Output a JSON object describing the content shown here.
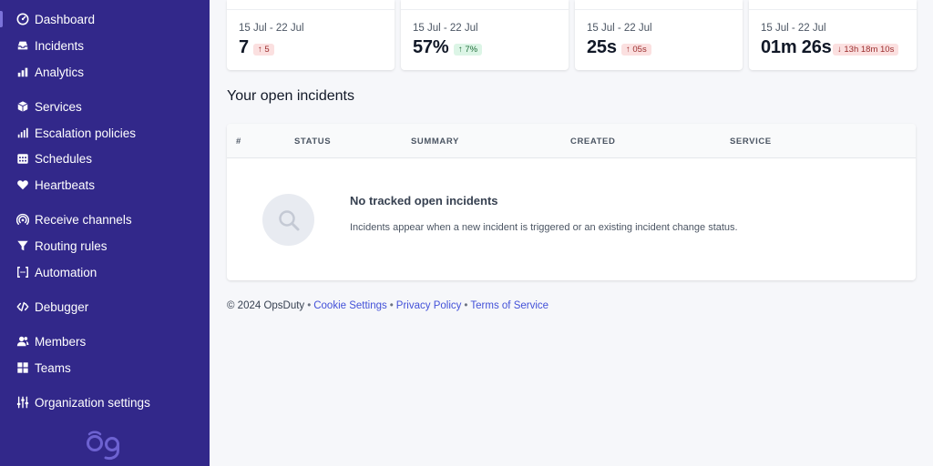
{
  "sidebar": {
    "items": [
      {
        "label": "Dashboard",
        "icon": "dashboard-icon"
      },
      {
        "label": "Incidents",
        "icon": "inbox-icon"
      },
      {
        "label": "Analytics",
        "icon": "analytics-icon"
      },
      {
        "label": "Services",
        "icon": "cube-icon"
      },
      {
        "label": "Escalation policies",
        "icon": "bars-icon"
      },
      {
        "label": "Schedules",
        "icon": "calendar-icon"
      },
      {
        "label": "Heartbeats",
        "icon": "heart-icon"
      },
      {
        "label": "Receive channels",
        "icon": "broadcast-icon"
      },
      {
        "label": "Routing rules",
        "icon": "funnel-icon"
      },
      {
        "label": "Automation",
        "icon": "automation-icon"
      },
      {
        "label": "Debugger",
        "icon": "code-icon"
      },
      {
        "label": "Members",
        "icon": "users-icon"
      },
      {
        "label": "Teams",
        "icon": "grid-icon"
      },
      {
        "label": "Organization settings",
        "icon": "sliders-icon"
      }
    ]
  },
  "stats": [
    {
      "range": "15 Jul - 22 Jul",
      "value": "7",
      "delta": "↑ 5",
      "trend": "up-bad"
    },
    {
      "range": "15 Jul - 22 Jul",
      "value": "57%",
      "delta": "↑ 7%",
      "trend": "up-good"
    },
    {
      "range": "15 Jul - 22 Jul",
      "value": "25s",
      "delta": "↑ 05s",
      "trend": "up-bad"
    },
    {
      "range": "15 Jul - 22 Jul",
      "value": "01m 26s",
      "delta": "↓ 13h 18m 10s",
      "trend": "down-bad"
    }
  ],
  "incidents": {
    "title": "Your open incidents",
    "columns": [
      "#",
      "STATUS",
      "SUMMARY",
      "CREATED",
      "SERVICE"
    ],
    "empty_title": "No tracked open incidents",
    "empty_description": "Incidents appear when a new incident is triggered or an existing incident change status."
  },
  "footer": {
    "copyright": "© 2024 OpsDuty",
    "links": [
      "Cookie Settings",
      "Privacy Policy",
      "Terms of Service"
    ]
  },
  "colors": {
    "sidebar_bg": "#32288a",
    "link": "#4351d8",
    "badge_red_bg": "#fbe0e0",
    "badge_green_bg": "#dcf5e6"
  }
}
